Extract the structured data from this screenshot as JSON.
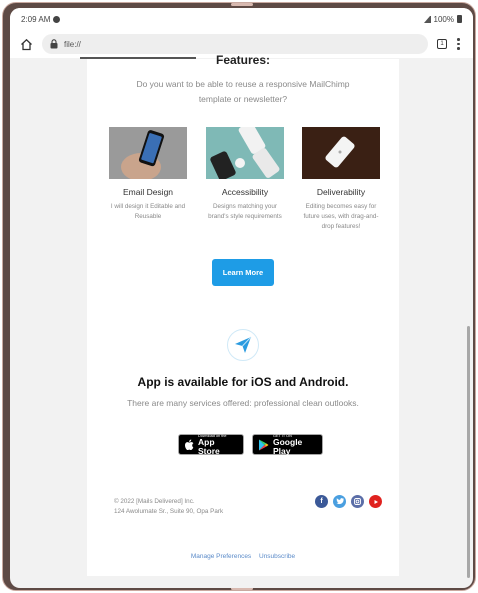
{
  "status_bar": {
    "time": "2:09 AM",
    "battery": "100%"
  },
  "browser": {
    "url": "file://",
    "tab_count": "1"
  },
  "email": {
    "section_title": "Features:",
    "intro": "Do you want to be able to reuse a responsive MailChimp template or newsletter?",
    "features": [
      {
        "title": "Email Design",
        "desc": "I will design it Editable and Reusable"
      },
      {
        "title": "Accessibility",
        "desc": "Designs matching your brand's style requirements"
      },
      {
        "title": "Deliverability",
        "desc": "Editing becomes easy for future uses, with drag-and-drop features!"
      }
    ],
    "cta_label": "Learn More",
    "app_title": "App is available for iOS and Android.",
    "app_subtitle": "There are many services offered: professional clean outlooks.",
    "app_store": {
      "small": "Download on the",
      "big": "App Store"
    },
    "google_play": {
      "small": "GET IT ON",
      "big": "Google Play"
    },
    "footer": {
      "copyright": "© 2022 [Mails Delivered] Inc.",
      "address": "124 Awolumate Sr., Suite 90, Opa Park",
      "manage": "Manage Preferences",
      "unsubscribe": "Unsubscribe"
    },
    "socials": [
      "facebook-icon",
      "twitter-icon",
      "instagram-icon",
      "youtube-icon"
    ]
  },
  "colors": {
    "accent": "#1e9ce6",
    "link": "#5b8bc9"
  }
}
